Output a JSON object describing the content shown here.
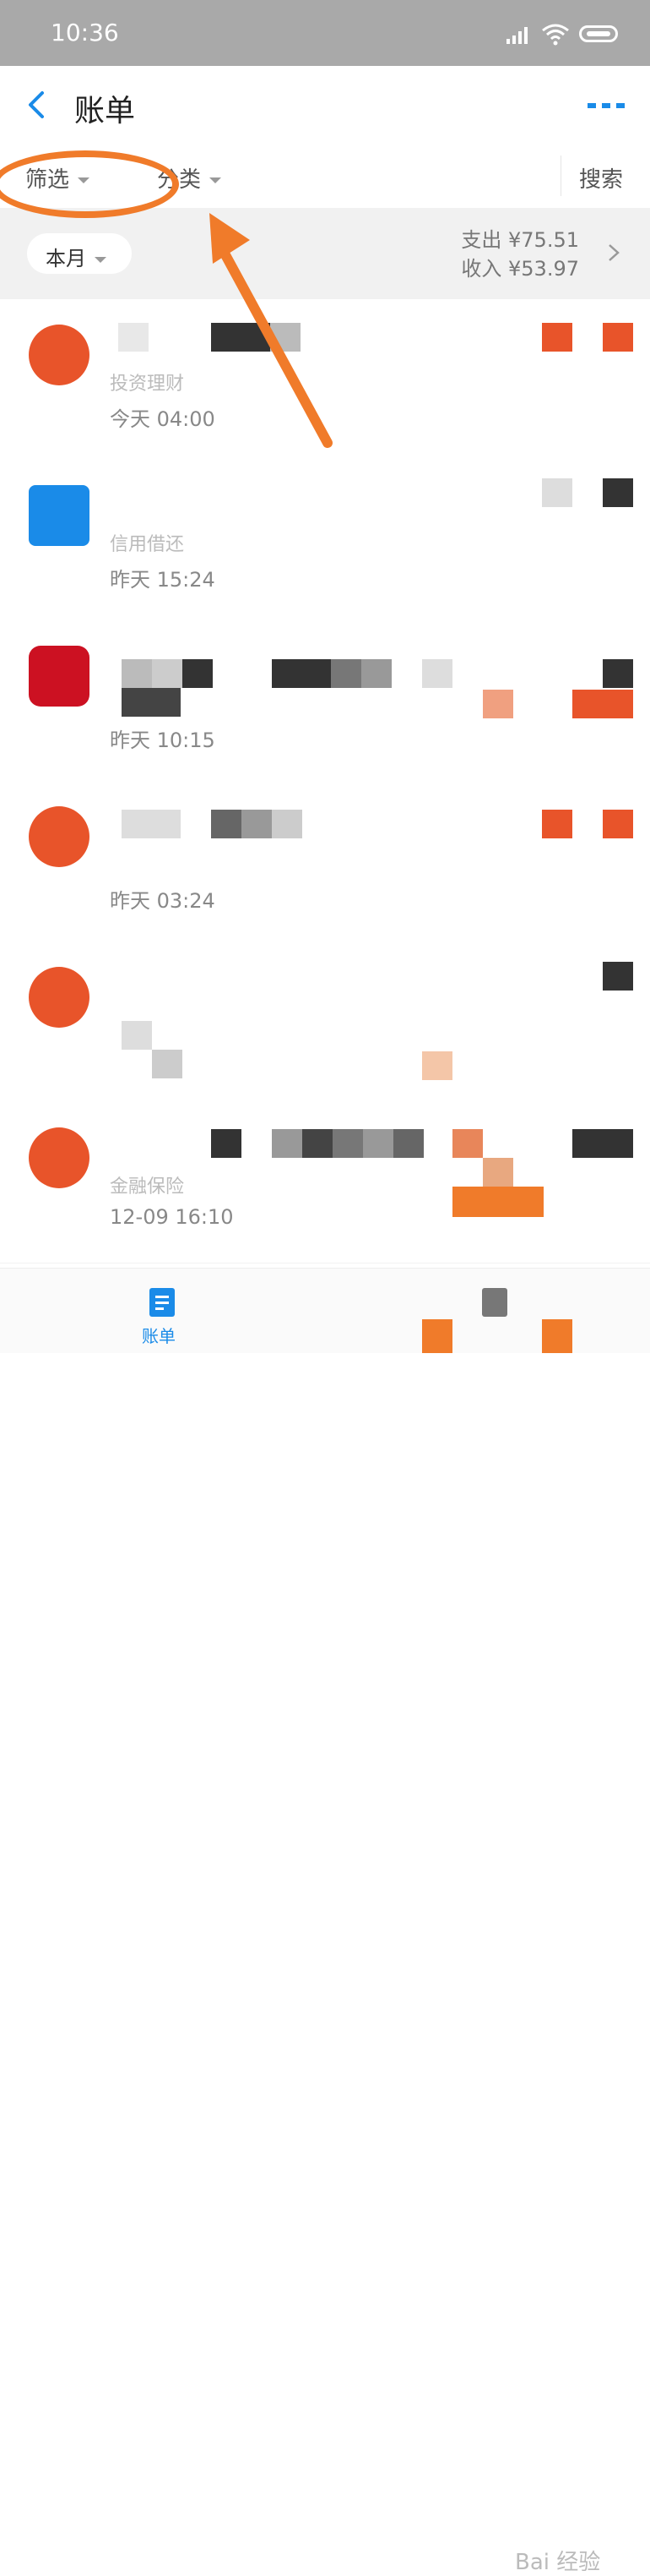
{
  "status_bar": {
    "time": "10:36"
  },
  "header": {
    "title": "账单"
  },
  "filter_bar": {
    "filter_label": "筛选",
    "category_label": "分类",
    "search_label": "搜索"
  },
  "summary": {
    "month_label": "本月",
    "expense": "支出 ¥75.51",
    "income": "收入 ¥53.97"
  },
  "transactions": [
    {
      "subtitle": "投资理财",
      "time": "今天 04:00",
      "icon_color": "#e8542a"
    },
    {
      "subtitle": "信用借还",
      "time": "昨天 15:24",
      "icon_color": "#1a8be8"
    },
    {
      "subtitle": "",
      "time": "昨天 10:15",
      "icon_color": "#cc1122"
    },
    {
      "subtitle": "",
      "time": "昨天 03:24",
      "icon_color": "#e8542a"
    },
    {
      "subtitle": "",
      "time": "",
      "icon_color": "#e8542a"
    },
    {
      "subtitle": "金融保险",
      "time": "12-09 16:10",
      "icon_color": "#e8542a"
    }
  ],
  "tab_bar": {
    "bill_label": "账单"
  },
  "watermark": "Bai 经验",
  "colors": {
    "accent": "#1a8be8",
    "annotation": "#f07b2a",
    "blur_dark": "#333333",
    "blur_orange": "#e8542a"
  }
}
